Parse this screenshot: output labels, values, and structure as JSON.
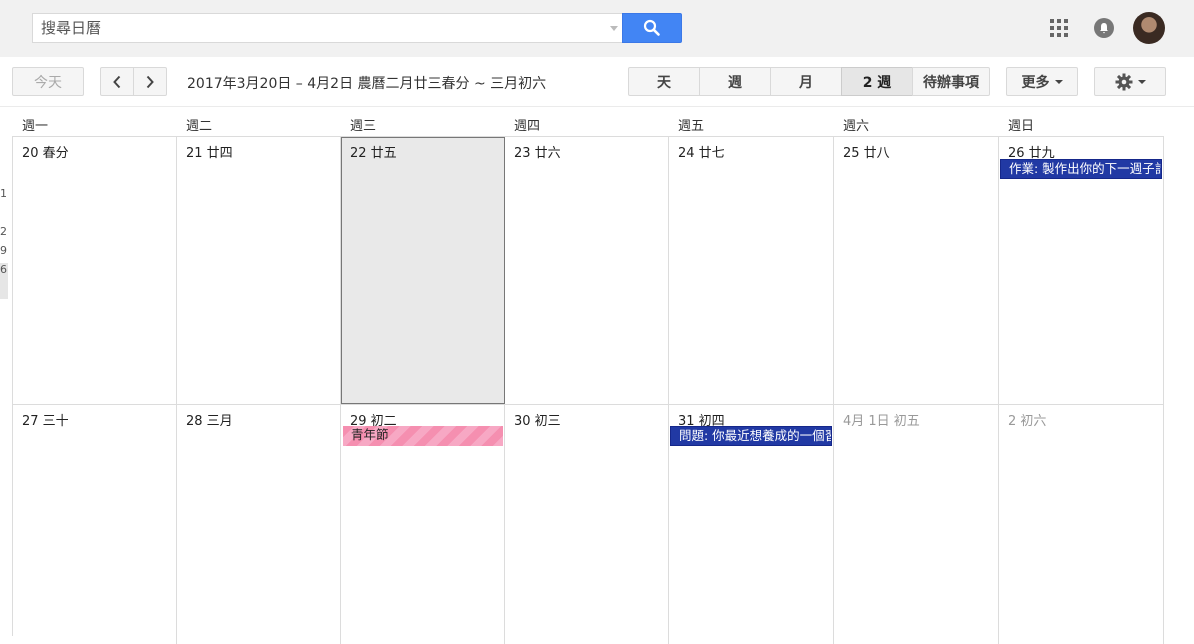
{
  "search": {
    "placeholder": "搜尋日曆"
  },
  "toolbar": {
    "today_label": "今天",
    "date_range": "2017年3月20日 – 4月2日 農曆二月廿三春分 ~ 三月初六",
    "views": [
      {
        "label": "天",
        "active": false
      },
      {
        "label": "週",
        "active": false
      },
      {
        "label": "月",
        "active": false
      },
      {
        "label": "2 週",
        "active": true
      },
      {
        "label": "待辦事項",
        "active": false
      }
    ],
    "more_label": "更多"
  },
  "weekdays": [
    "週一",
    "週二",
    "週三",
    "週四",
    "週五",
    "週六",
    "週日"
  ],
  "weeks": [
    {
      "days": [
        {
          "label": "20 春分"
        },
        {
          "label": "21 廿四"
        },
        {
          "label": "22 廿五",
          "today": true
        },
        {
          "label": "23 廿六"
        },
        {
          "label": "24 廿七"
        },
        {
          "label": "25 廿八"
        },
        {
          "label": "26 廿九",
          "event": {
            "title": "作業: 製作出你的下一週子計",
            "color": "#2139a4"
          }
        }
      ]
    },
    {
      "days": [
        {
          "label": "27 三十"
        },
        {
          "label": "28 三月"
        },
        {
          "label": "29 初二",
          "event": {
            "title": "青年節",
            "color": "#f58fb0"
          }
        },
        {
          "label": "30 初三"
        },
        {
          "label": "31 初四",
          "event": {
            "title": "問題: 你最近想養成的一個習",
            "color": "#2139a4"
          }
        },
        {
          "label": "4月 1日 初五",
          "other": true
        },
        {
          "label": "2 初六",
          "other": true
        }
      ]
    }
  ],
  "left_stub": [
    "1",
    "2",
    "9",
    "6"
  ],
  "colors": {
    "accent": "#4285f4",
    "event_blue": "#2139a4",
    "event_pink": "#f58fb0"
  }
}
